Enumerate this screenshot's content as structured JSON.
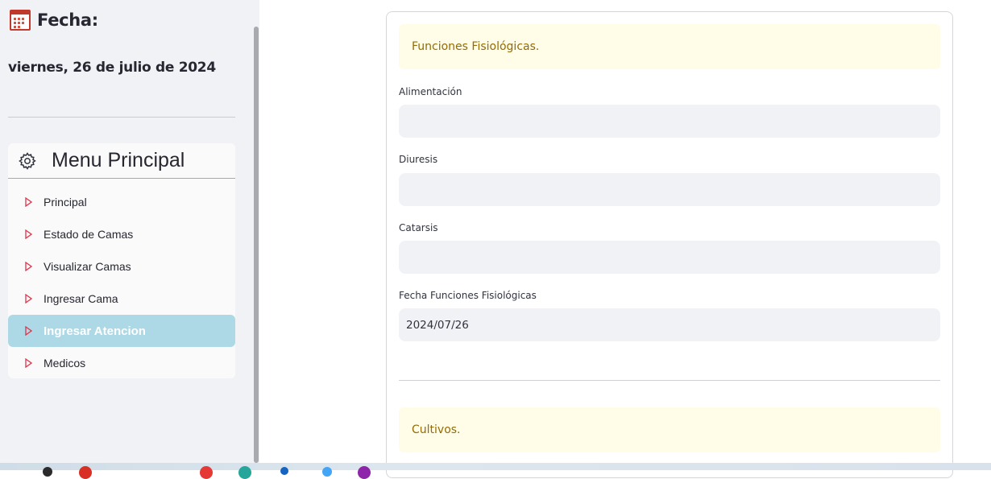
{
  "sidebar": {
    "fecha_label": "Fecha:",
    "date": "viernes, 26 de julio de 2024",
    "menu": {
      "title": "Menu Principal",
      "items": [
        {
          "label": "Principal",
          "active": false
        },
        {
          "label": "Estado de Camas",
          "active": false
        },
        {
          "label": "Visualizar Camas",
          "active": false
        },
        {
          "label": "Ingresar Cama",
          "active": false
        },
        {
          "label": "Ingresar Atencion",
          "active": true
        },
        {
          "label": "Medicos",
          "active": false
        }
      ]
    }
  },
  "main": {
    "section1_title": "Funciones Fisiológicas.",
    "fields": {
      "alimentacion": {
        "label": "Alimentación",
        "value": ""
      },
      "diuresis": {
        "label": "Diuresis",
        "value": ""
      },
      "catarsis": {
        "label": "Catarsis",
        "value": ""
      },
      "fecha": {
        "label": "Fecha Funciones Fisiológicas",
        "value": "2024/07/26"
      }
    },
    "section2_title": "Cultivos."
  },
  "colors": {
    "sidebar_bg": "#f0f2f6",
    "menu_active_bg": "#add8e6",
    "triangle_red": "#e0344b",
    "alert_bg": "#fffce7",
    "alert_text": "#926c05"
  }
}
